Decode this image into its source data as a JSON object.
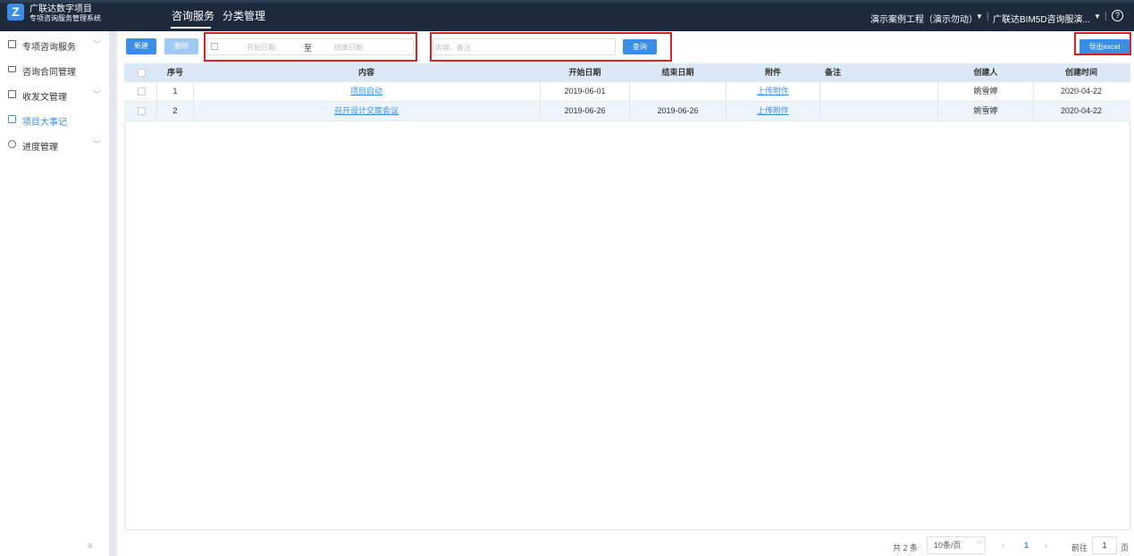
{
  "app": {
    "logo_letter": "Z",
    "title": "广联达数字项目",
    "subtitle": "专项咨询服务管理系统"
  },
  "nav": {
    "tabs": [
      {
        "label": "咨询服务",
        "active": true
      },
      {
        "label": "分类管理",
        "active": false
      }
    ],
    "project": "演示案例工程（演示勿动）",
    "company": "广联达BIM5D咨询服演...",
    "help": "?"
  },
  "sidebar": {
    "items": [
      {
        "label": "专项咨询服务",
        "icon": "document-icon",
        "expandable": true
      },
      {
        "label": "咨询合同管理",
        "icon": "contract-icon",
        "expandable": false
      },
      {
        "label": "收发文管理",
        "icon": "mail-icon",
        "expandable": true
      },
      {
        "label": "项目大事记",
        "icon": "record-icon",
        "expandable": false,
        "active": true
      },
      {
        "label": "进度管理",
        "icon": "clock-icon",
        "expandable": true
      }
    ],
    "collapse": "≡"
  },
  "toolbar": {
    "new_label": "新建",
    "delete_label": "删除",
    "start_placeholder": "开始日期",
    "to_label": "至",
    "end_placeholder": "结束日期",
    "search_placeholder": "内容、备注",
    "query_label": "查询",
    "export_label": "导出excel"
  },
  "table": {
    "headers": [
      "",
      "序号",
      "内容",
      "开始日期",
      "结束日期",
      "附件",
      "备注",
      "创建人",
      "创建时间"
    ],
    "rows": [
      {
        "no": "1",
        "content": "项目启动",
        "start": "2019-06-01",
        "end": "",
        "attachment": "上传附件",
        "remark": "",
        "creator": "姚雪婷",
        "created": "2020-04-22"
      },
      {
        "no": "2",
        "content": "召开设计交底会议",
        "start": "2019-06-26",
        "end": "2019-06-26",
        "attachment": "上传附件",
        "remark": "",
        "creator": "姚雪婷",
        "created": "2020-04-22"
      }
    ]
  },
  "pagination": {
    "total": "共 2 条",
    "page_size": "10条/页",
    "prev": "‹",
    "current": "1",
    "next": "›",
    "goto_label": "前往",
    "goto_value": "1",
    "page_suffix": "页"
  }
}
